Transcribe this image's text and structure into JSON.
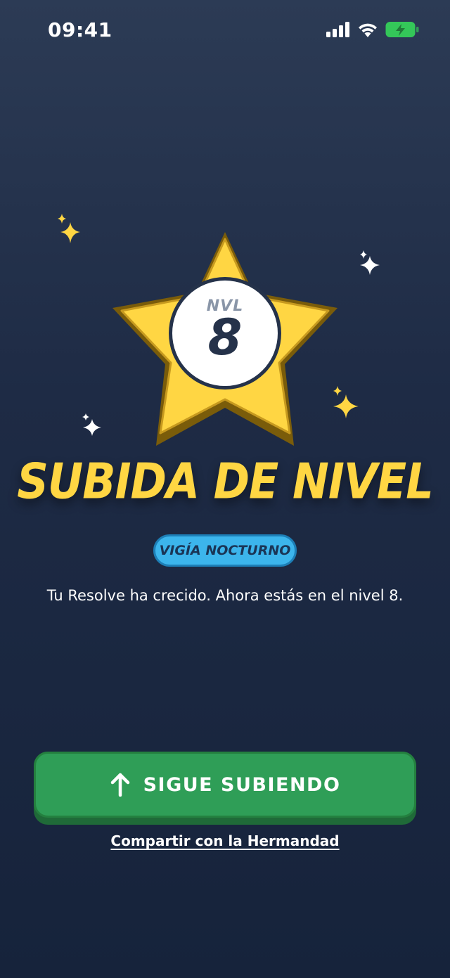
{
  "status_bar": {
    "time": "09:41",
    "icons": [
      "signal-icon",
      "wifi-icon",
      "battery-charging-icon"
    ]
  },
  "badge": {
    "prefix": "NVL",
    "level": "8"
  },
  "headline": "SUBIDA DE NIVEL",
  "rank_title": "VIGÍA NOCTURNO",
  "subtitle": "Tu Resolve ha crecido. Ahora estás en el nivel 8.",
  "primary_button": {
    "label": "SIGUE SUBIENDO",
    "icon": "arrow-up-icon"
  },
  "share_link": "Compartir con la Hermandad",
  "colors": {
    "background": "#1e2b45",
    "star": "#ffd643",
    "star_outline": "#8a6a10",
    "headline": "#ffd643",
    "pill": "#3cb5ec",
    "button": "#2f9e57",
    "battery": "#34c759"
  }
}
